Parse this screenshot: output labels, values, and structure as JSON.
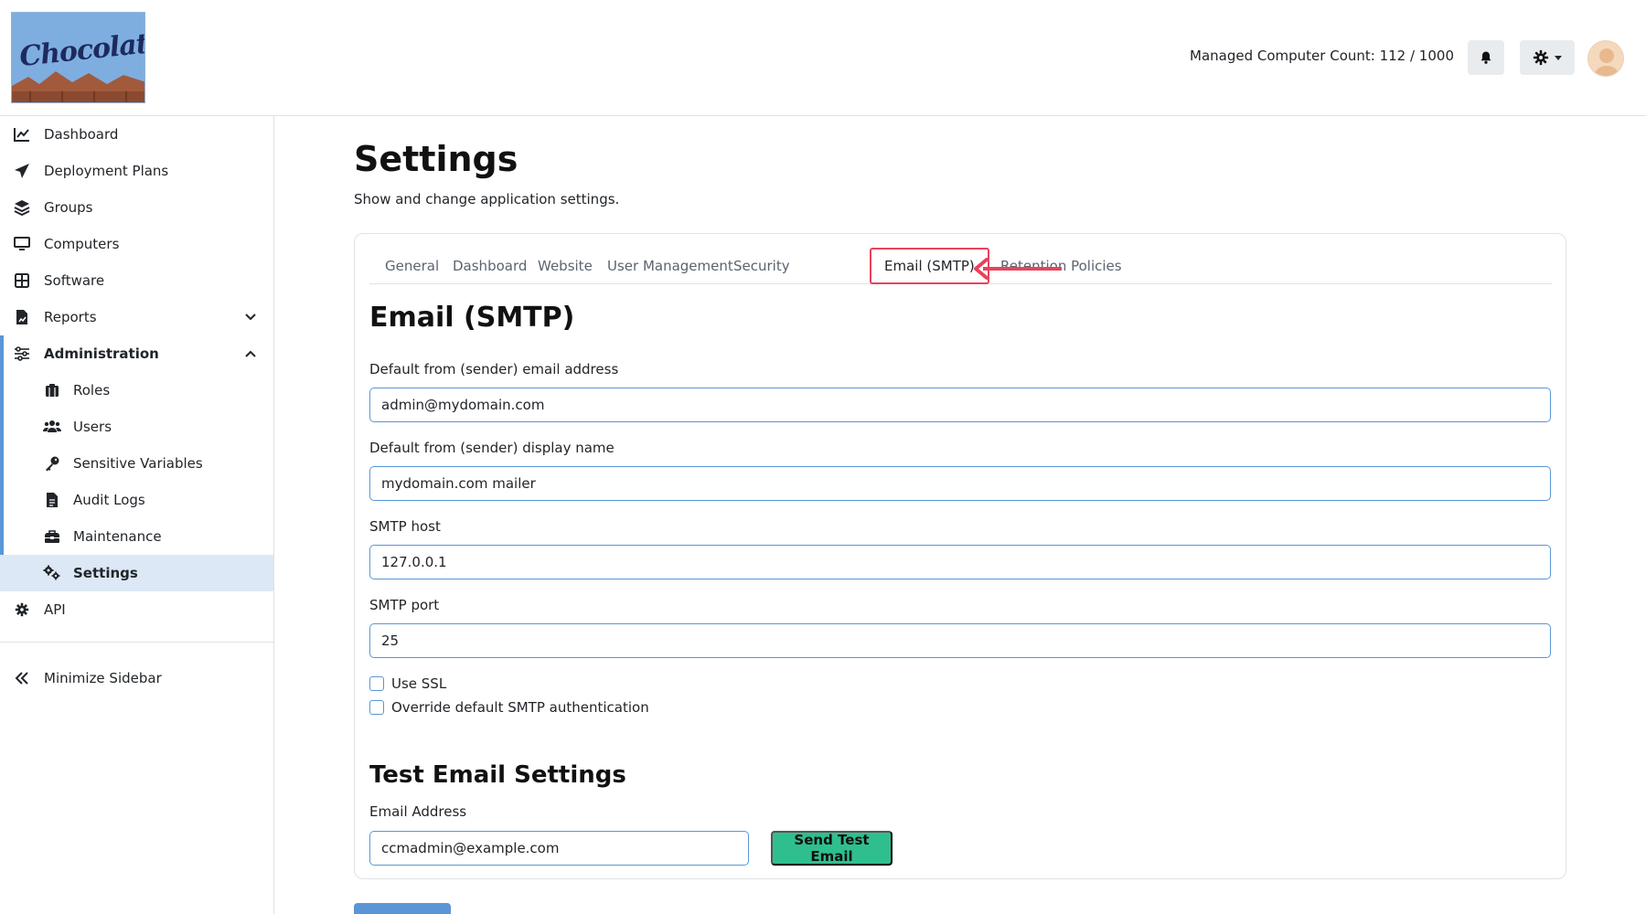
{
  "header": {
    "logo_text": "Chocolatey",
    "managed_count_label": "Managed Computer Count: 112 / 1000"
  },
  "sidebar": {
    "items": [
      {
        "label": "Dashboard"
      },
      {
        "label": "Deployment Plans"
      },
      {
        "label": "Groups"
      },
      {
        "label": "Computers"
      },
      {
        "label": "Software"
      },
      {
        "label": "Reports"
      },
      {
        "label": "Administration"
      },
      {
        "label": "Roles"
      },
      {
        "label": "Users"
      },
      {
        "label": "Sensitive Variables"
      },
      {
        "label": "Audit Logs"
      },
      {
        "label": "Maintenance"
      },
      {
        "label": "Settings"
      },
      {
        "label": "API"
      }
    ],
    "minimize_label": "Minimize Sidebar"
  },
  "page": {
    "title": "Settings",
    "subtitle": "Show and change application settings."
  },
  "tabs": [
    {
      "label": "General"
    },
    {
      "label": "Dashboard"
    },
    {
      "label": "Website"
    },
    {
      "label": "User Management"
    },
    {
      "label": "Security"
    },
    {
      "label": "Email (SMTP)"
    },
    {
      "label": "Retention Policies"
    }
  ],
  "smtp": {
    "heading": "Email (SMTP)",
    "from_email_label": "Default from (sender) email address",
    "from_email_value": "admin@mydomain.com",
    "display_name_label": "Default from (sender) display name",
    "display_name_value": "mydomain.com mailer",
    "host_label": "SMTP host",
    "host_value": "127.0.0.1",
    "port_label": "SMTP port",
    "port_value": "25",
    "use_ssl_label": "Use SSL",
    "override_auth_label": "Override default SMTP authentication"
  },
  "test_email": {
    "heading": "Test Email Settings",
    "address_label": "Email Address",
    "address_value": "ccmadmin@example.com",
    "send_label": "Send Test Email"
  },
  "colors": {
    "accent": "#5a96d6",
    "highlight_border": "#e7435c",
    "send_button": "#2fbf8f",
    "active_nav_bg": "#dce8f5"
  }
}
